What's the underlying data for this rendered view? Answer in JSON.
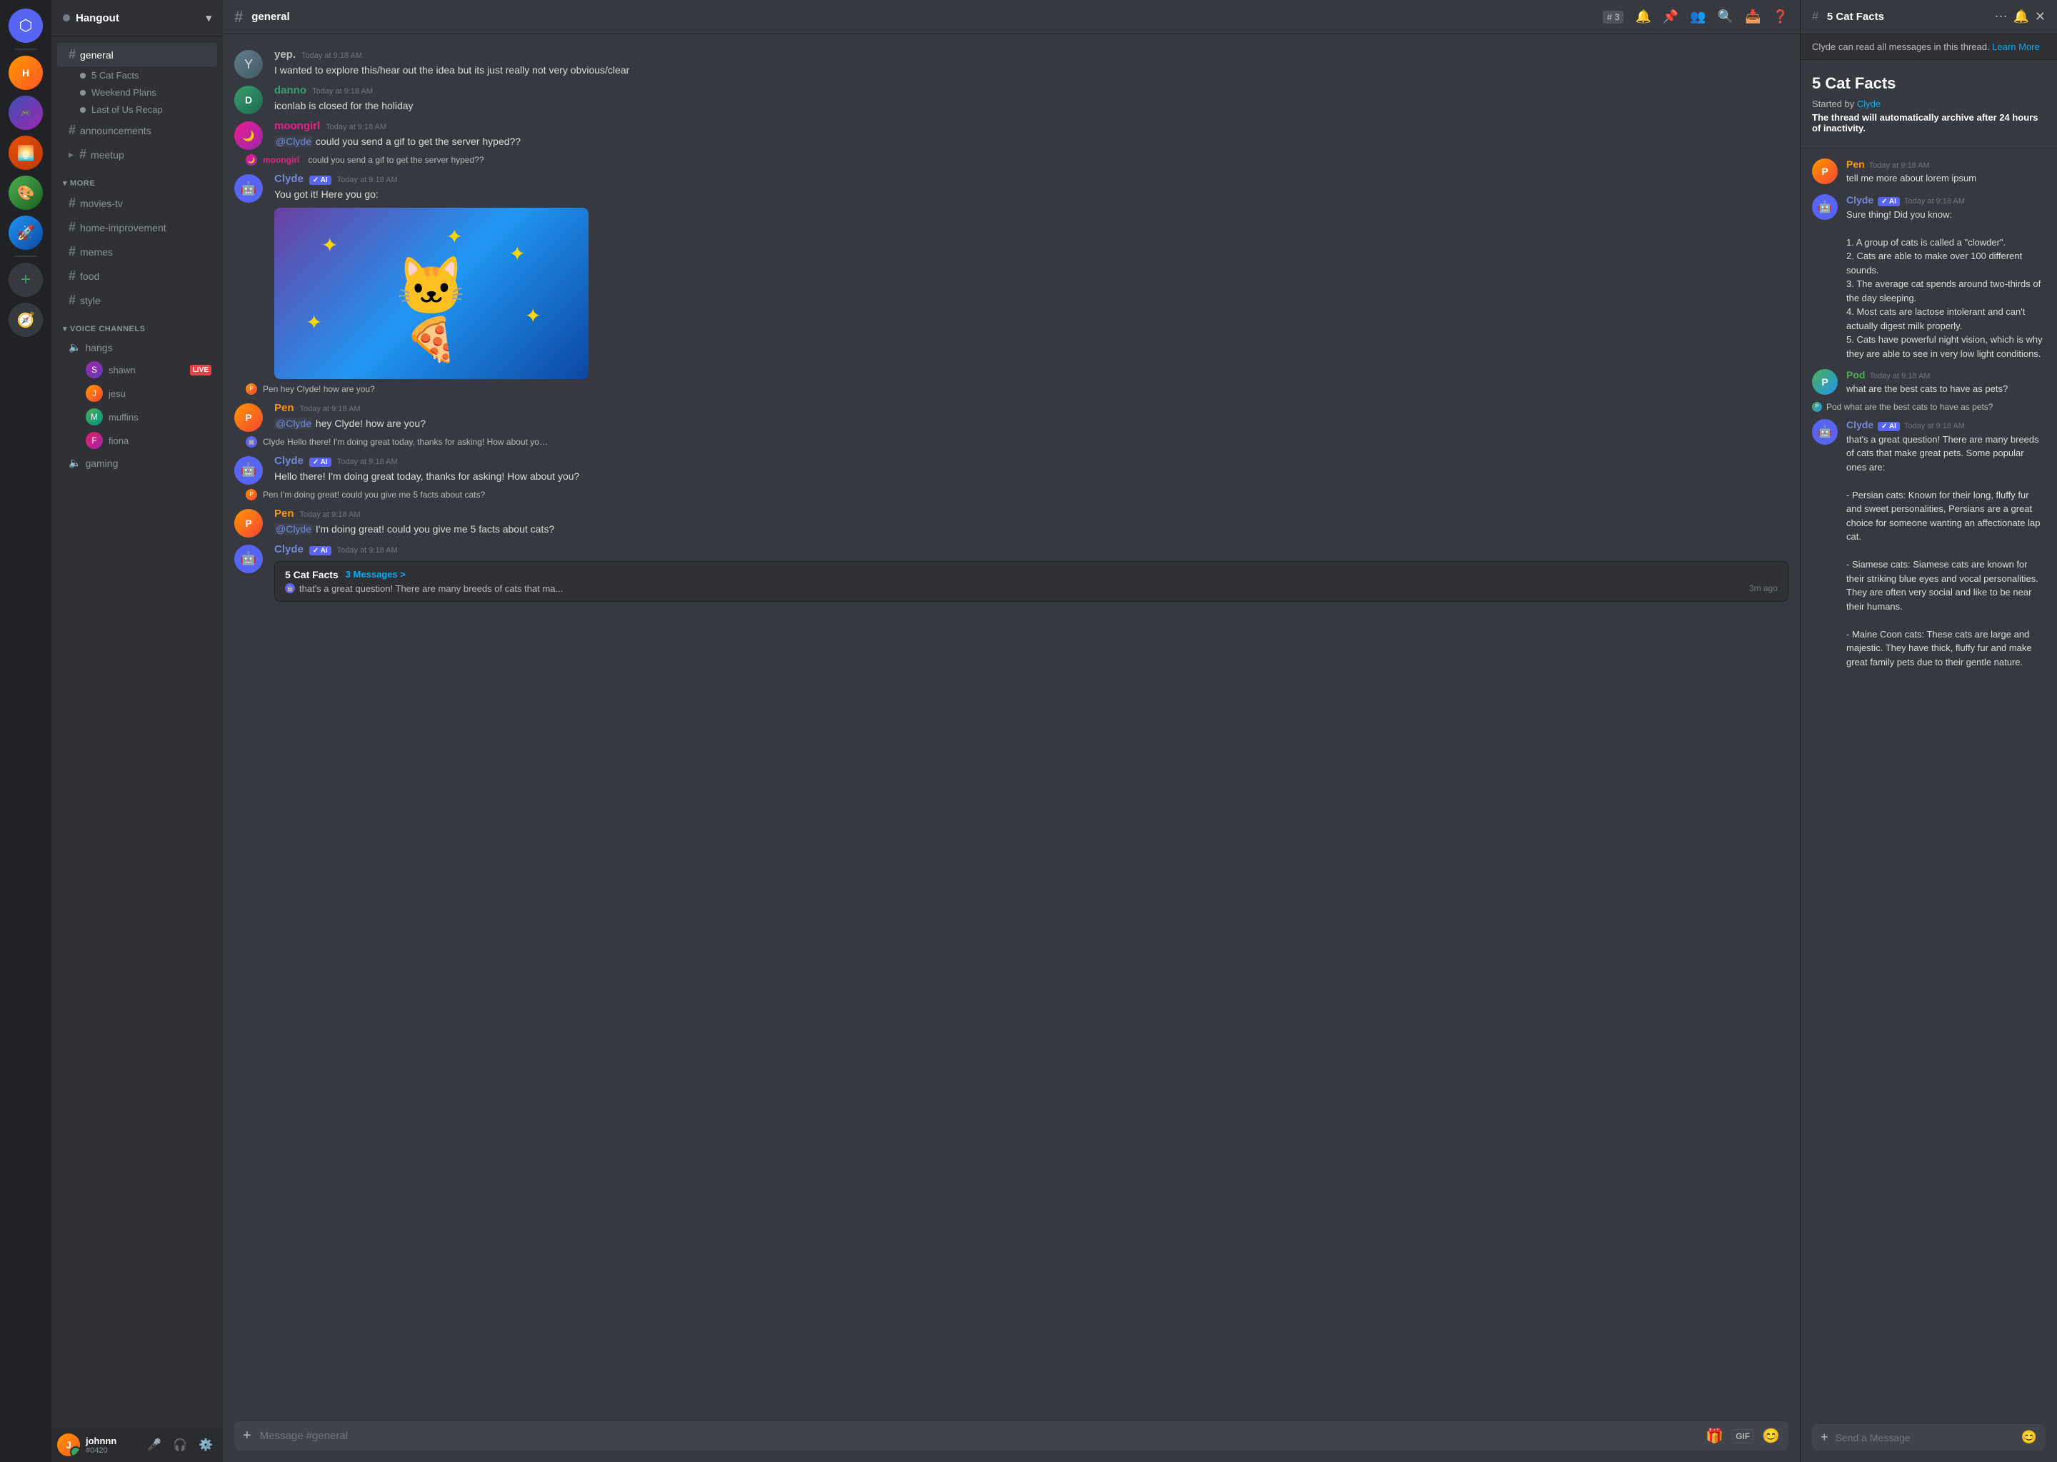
{
  "app": {
    "title": "Discord"
  },
  "server": {
    "name": "Hangout",
    "status_color": "#747f8d"
  },
  "sidebar": {
    "sections": [
      {
        "id": "text",
        "channels": [
          {
            "id": "general",
            "name": "general",
            "active": true,
            "threads": [
              {
                "name": "5 Cat Facts"
              },
              {
                "name": "Weekend Plans"
              },
              {
                "name": "Last of Us Recap"
              }
            ]
          },
          {
            "id": "announcements",
            "name": "announcements",
            "active": false,
            "threads": []
          },
          {
            "id": "meetup",
            "name": "meetup",
            "active": false,
            "threads": []
          }
        ]
      },
      {
        "id": "more",
        "label": "MORE",
        "channels": [
          {
            "id": "movies-tv",
            "name": "movies-tv"
          },
          {
            "id": "home-improvement",
            "name": "home-improvement"
          },
          {
            "id": "memes",
            "name": "memes"
          },
          {
            "id": "food",
            "name": "food"
          },
          {
            "id": "style",
            "name": "style"
          }
        ]
      }
    ],
    "voice": {
      "label": "VOICE CHANNELS",
      "channels": [
        {
          "id": "hangs",
          "name": "hangs",
          "users": [
            {
              "name": "shawn",
              "live": true
            },
            {
              "name": "jesu",
              "live": false
            },
            {
              "name": "muffins",
              "live": false
            },
            {
              "name": "fiona",
              "live": false
            }
          ]
        },
        {
          "id": "gaming",
          "name": "gaming",
          "users": []
        }
      ]
    }
  },
  "chat": {
    "channel_name": "general",
    "thread_count": "3",
    "messages": [
      {
        "id": "msg1",
        "author": "yep.",
        "color": "",
        "time": "Today at 9:18 AM",
        "text": "I wanted to explore this/hear out the idea but its just really not very obvious/clear",
        "quoted": false
      },
      {
        "id": "msg2",
        "author": "danno",
        "color": "color-danno",
        "time": "Today at 9:18 AM",
        "text": "iconlab is closed for the holiday",
        "quoted": false
      },
      {
        "id": "msg3",
        "author": "moongirl",
        "color": "color-moongirl",
        "time": "Today at 9:18 AM",
        "text": "@Clyde could you send a gif to get the server hyped??",
        "quoted": false
      },
      {
        "id": "msg4",
        "author": "Clyde",
        "color": "color-clyde",
        "ai": true,
        "time": "Today at 9:18 AM",
        "text": "You got it! Here you go:",
        "has_image": true,
        "quoted_text": "moongirl could you send a gif to get the server hyped??",
        "quoted_author": "moongirl"
      },
      {
        "id": "msg5",
        "author": "Pen",
        "color": "color-pen",
        "time": "Today at 9:18 AM",
        "text": "@Clyde hey Clyde! how are you?",
        "quoted_text": "Pen hey Clyde! how are you?",
        "quoted_author": "Pen"
      },
      {
        "id": "msg6",
        "author": "Clyde",
        "color": "color-clyde",
        "ai": true,
        "time": "Today at 9:18 AM",
        "text": "Hello there! I'm doing great today, thanks for asking! How about you?",
        "quoted_text": "Clyde Hello there! I'm doing great today, thanks for asking! How about you?",
        "quoted_author": "Clyde"
      },
      {
        "id": "msg7",
        "author": "Pen",
        "color": "color-pen",
        "time": "Today at 9:18 AM",
        "text": "@Clyde I'm doing great! could you give me 5 facts about cats?",
        "quoted_text": "Pen I'm doing great! could you give me 5 facts about cats?",
        "quoted_author": "Pen"
      },
      {
        "id": "msg8",
        "author": "Clyde",
        "color": "color-clyde",
        "ai": true,
        "time": "Today at 9:18 AM",
        "has_thread": true,
        "thread_name": "5 Cat Facts",
        "thread_count": "3 Messages",
        "thread_preview": "that's a great question! There are many breeds of cats that ma...",
        "thread_time": "3m ago"
      }
    ],
    "input_placeholder": "Message #general"
  },
  "thread": {
    "title": "5 Cat Facts",
    "banner": "Clyde can read all messages in this thread.",
    "banner_link": "Learn More",
    "started_by": "Clyde",
    "archive_text": "The thread will automatically archive after",
    "archive_hours": "24 hours",
    "archive_suffix": "of inactivity.",
    "messages": [
      {
        "id": "t1",
        "author": "Pen",
        "color": "color-pen",
        "time": "Today at 9:18 AM",
        "text": "tell me more about lorem ipsum",
        "quoted": false
      },
      {
        "id": "t2",
        "author": "Clyde",
        "color": "color-clyde",
        "ai": true,
        "time": "Today at 9:18 AM",
        "text_intro": "Sure thing! Did you know:",
        "facts": [
          "1. A group of cats is called a \"clowder\".",
          "2. Cats are able to make over 100 different sounds.",
          "3. The average cat spends around two-thirds of the day sleeping.",
          "4. Most cats are lactose intolerant and can't actually digest milk properly.",
          "5. Cats have powerful night vision, which is why they are able to see in very low light conditions."
        ]
      },
      {
        "id": "t3",
        "author": "Pod",
        "color": "color-pod",
        "time": "Today at 9:18 AM",
        "text": "what are the best cats to have as pets?",
        "quoted": false
      },
      {
        "id": "t4",
        "author": "Clyde",
        "color": "color-clyde",
        "ai": true,
        "time": "Today at 9:18 AM",
        "quoted_text": "Pod what are the best cats to have as pets?",
        "quoted_author": "Pod",
        "text_intro": "that's a great question! There are many breeds of cats that make great pets. Some popular ones are:",
        "breeds": [
          "- Persian cats: Known for their long, fluffy fur and sweet personalities, Persians are a great choice for someone wanting an affectionate lap cat.",
          "- Siamese cats: Siamese cats are known for their striking blue eyes and vocal personalities. They are often very social and like to be near their humans.",
          "- Maine Coon cats: These cats are large and majestic. They have thick, fluffy fur and make great family pets due to their gentle nature."
        ]
      }
    ],
    "input_placeholder": "Send a Message"
  },
  "user": {
    "name": "johnnn",
    "tag": "#0420",
    "status": "online"
  }
}
